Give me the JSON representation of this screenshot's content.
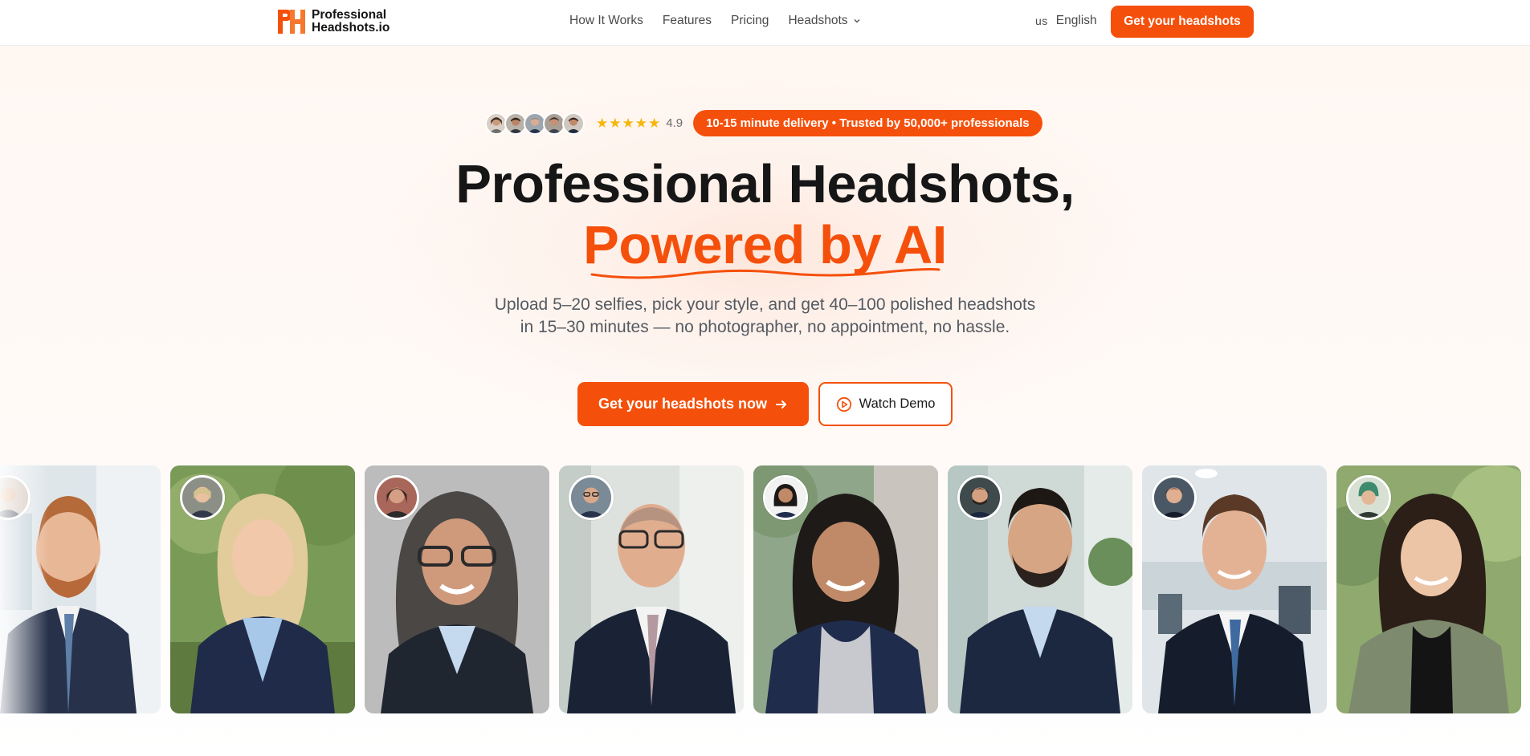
{
  "brand": {
    "line1": "Professional",
    "line2": "Headshots.io",
    "accent": "#f5500b"
  },
  "nav": {
    "items": [
      "How It Works",
      "Features",
      "Pricing"
    ],
    "dropdown_label": "Headshots",
    "flag": "us",
    "language": "English",
    "cta": "Get your headshots"
  },
  "hero": {
    "rating": "4.9",
    "badge": "10-15 minute delivery • Trusted by 50,000+ professionals",
    "title_line1": "Professional Headshots,",
    "title_line2": "Powered by AI",
    "subtitle": "Upload 5–20 selfies, pick your style, and get 40–100 polished headshots in 15–30 minutes — no photographer, no appointment, no hassle.",
    "primary_cta": "Get your headshots now",
    "secondary_cta": "Watch Demo"
  },
  "gallery": {
    "count": 8,
    "icons": [
      "headshot-photo"
    ]
  }
}
